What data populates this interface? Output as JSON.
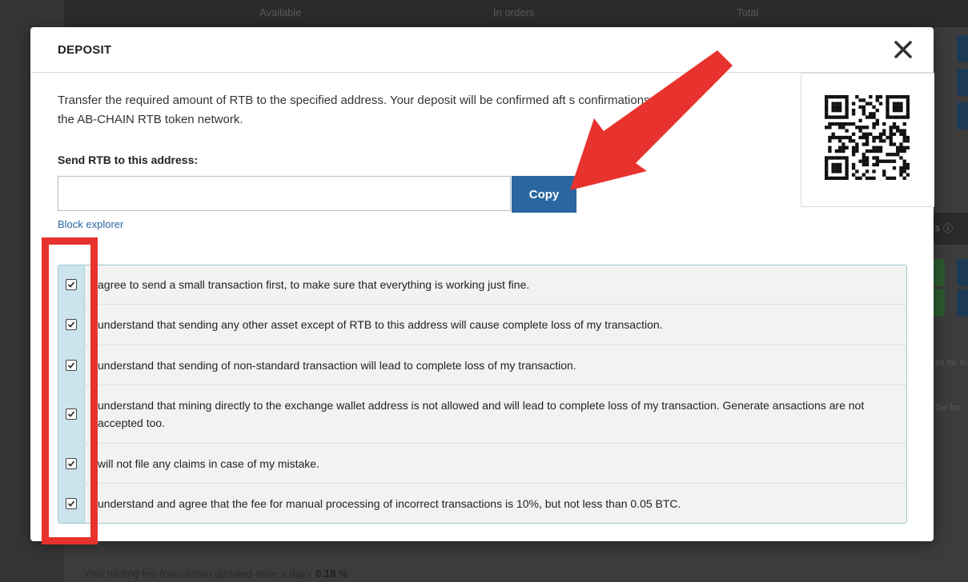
{
  "background": {
    "header_cols": [
      "Available",
      "In orders",
      "Total"
    ],
    "fee_text": "Your trading fee (calculation updated once a day): ",
    "fee_value": "0.18 %",
    "right_label_fragment": "s",
    "side_text_1": "es for th",
    "side_text_2": "the bo"
  },
  "modal": {
    "title": "DEPOSIT",
    "close_icon": "close-icon",
    "description": "Transfer the required amount of RTB to the specified address. Your deposit will be confirmed aft      s confirmations from the AB-CHAIN RTB token network.",
    "address_label": "Send RTB to this address:",
    "address_value": "",
    "copy_label": "Copy",
    "explorer_label": "Block explorer",
    "agreements": [
      {
        "text": "agree to send a small transaction first, to make sure that everything is working just fine.",
        "checked": true
      },
      {
        "text": "understand that sending any other asset except of RTB to this address will cause complete loss of my transaction.",
        "checked": true
      },
      {
        "text": "understand that sending of non-standard transaction will lead to complete loss of my transaction.",
        "checked": true
      },
      {
        "text": "understand that mining directly to the exchange wallet address is not allowed and will lead to complete loss of my transaction. Generate ansactions are not accepted too.",
        "checked": true
      },
      {
        "text": "will not file any claims in case of my mistake.",
        "checked": true
      },
      {
        "text": "understand and agree that the fee for manual processing of incorrect transactions is 10%, but not less than 0.05 BTC.",
        "checked": true
      }
    ]
  },
  "colors": {
    "accent": "#2a67a0",
    "annotation_red": "#e8322d",
    "agree_border": "#9bc7cf"
  }
}
